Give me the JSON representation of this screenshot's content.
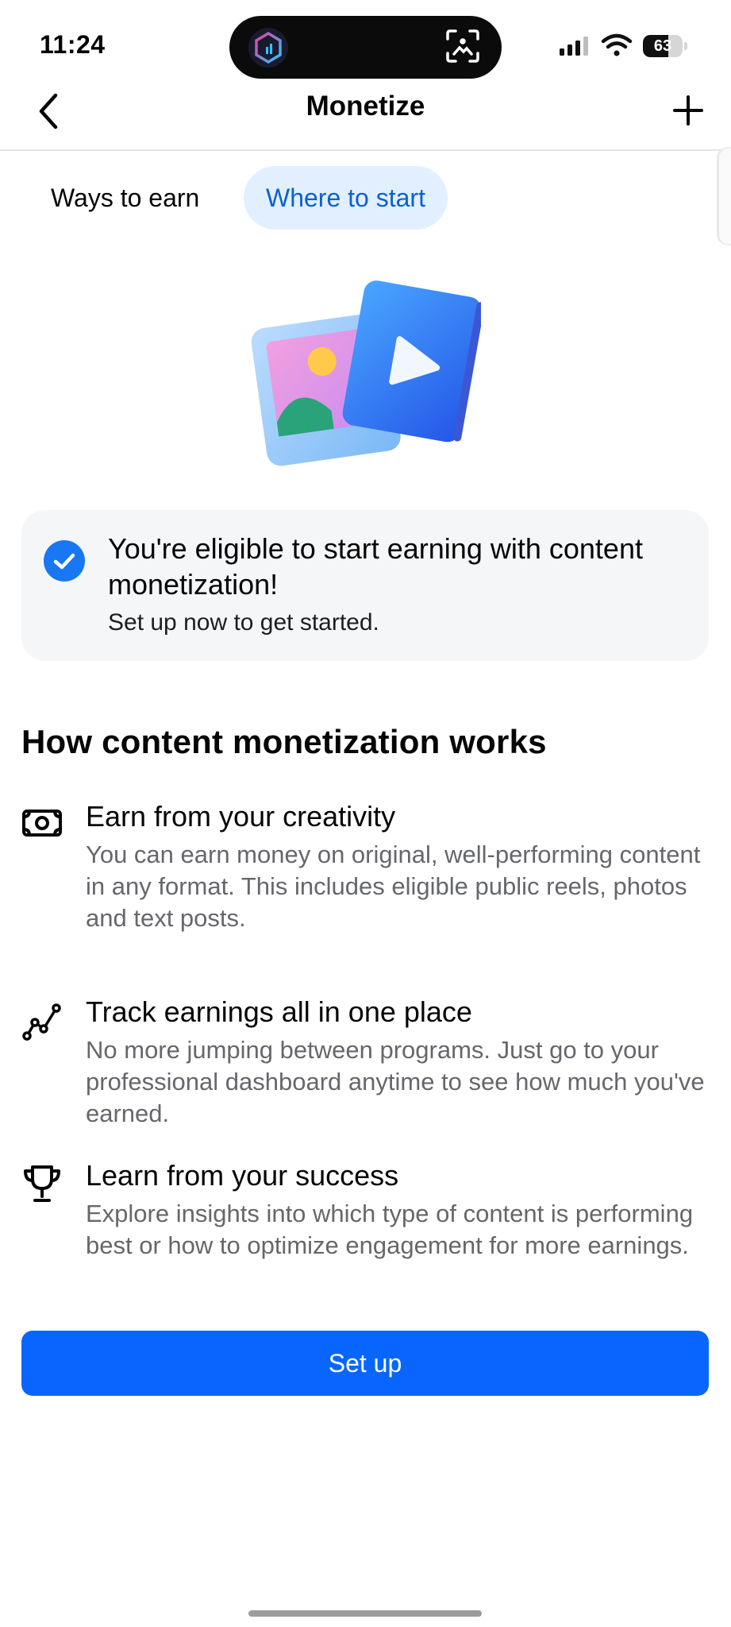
{
  "status_bar": {
    "time": "11:24",
    "battery": "63",
    "battery_level": 0.63
  },
  "nav": {
    "title": "Monetize"
  },
  "tabs": [
    {
      "label": "Ways to earn",
      "active": false
    },
    {
      "label": "Where to start",
      "active": true
    }
  ],
  "eligibility": {
    "title": "You're eligible to start earning with content monetization!",
    "subtitle": "Set up now to get started."
  },
  "section": {
    "title": "How content monetization works",
    "features": [
      {
        "icon": "money-icon",
        "title": "Earn from your creativity",
        "body": "You can earn money on original, well-performing content in any format. This includes eligible public reels, photos and text posts."
      },
      {
        "icon": "trend-line-icon",
        "title": "Track earnings all in one place",
        "body": "No more jumping between programs. Just go to your professional dashboard anytime to see how much you've earned."
      },
      {
        "icon": "trophy-icon",
        "title": "Learn from your success",
        "body": "Explore insights into which type of content is performing best or how to optimize engagement for more earnings."
      }
    ]
  },
  "setup_button": {
    "label": "Set up"
  },
  "colors": {
    "accent": "#0866ff",
    "tab_active_bg": "#e2efff",
    "tab_active_text": "#0a62cc",
    "check": "#1877f2"
  }
}
